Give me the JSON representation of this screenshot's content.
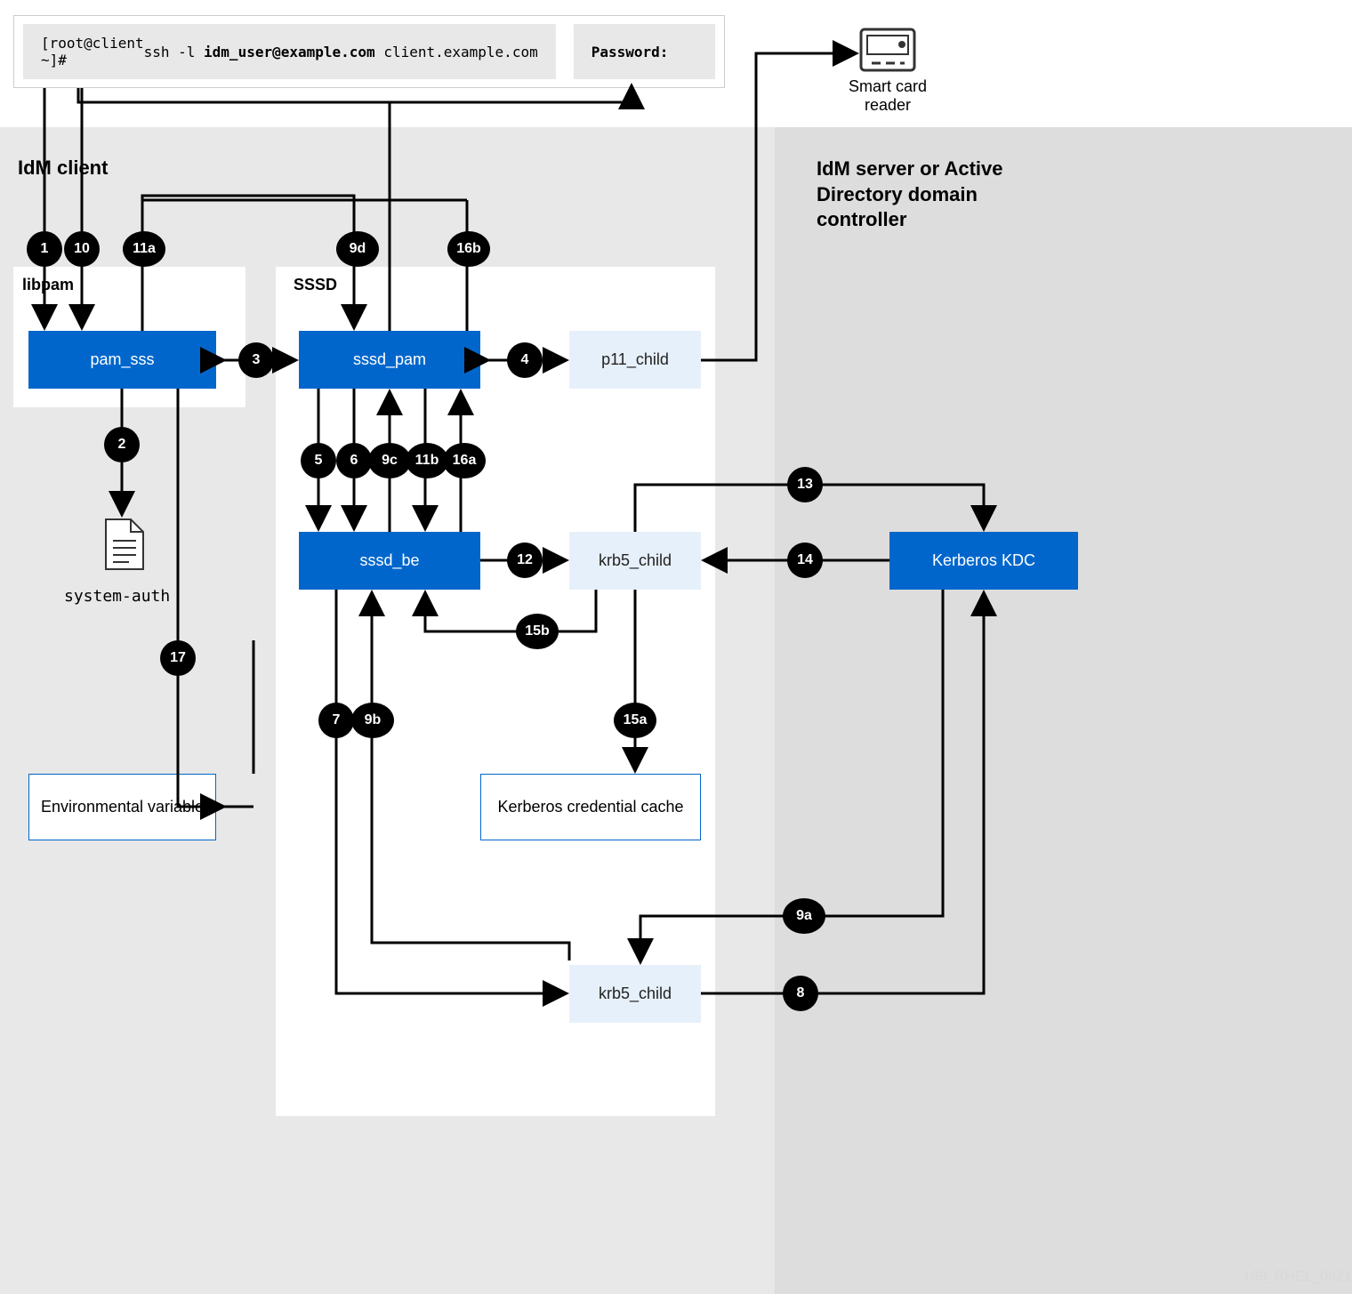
{
  "terminal": {
    "prompt": "[root@client ~]# ",
    "ssh_cmd_1": "ssh -l ",
    "ssh_user": "idm_user@example.com",
    "ssh_cmd_2": " client.example.com",
    "password_label": "Password:"
  },
  "smartcard": {
    "label": "Smart card reader"
  },
  "idm_client_label": "IdM client",
  "idm_server_label": "IdM server or Active Directory domain controller",
  "libpam_label": "libpam",
  "sssd_label": "SSSD",
  "boxes": {
    "pam_sss": "pam_sss",
    "sssd_pam": "sssd_pam",
    "sssd_be": "sssd_be",
    "p11_child": "p11_child",
    "krb5_child_1": "krb5_child",
    "krb5_child_2": "krb5_child",
    "kerberos_kdc": "Kerberos KDC",
    "env_var": "Environmental variable",
    "kerb_cache": "Kerberos credential cache",
    "system_auth": "system-auth"
  },
  "badges": {
    "1": "1",
    "2": "2",
    "3": "3",
    "4": "4",
    "5": "5",
    "6": "6",
    "7": "7",
    "8": "8",
    "9a": "9a",
    "9b": "9b",
    "9c": "9c",
    "9d": "9d",
    "10": "10",
    "11a": "11a",
    "11b": "11b",
    "12": "12",
    "13": "13",
    "14": "14",
    "15a": "15a",
    "15b": "15b",
    "16a": "16a",
    "16b": "16b",
    "17": "17"
  },
  "footer_code": "169_RHEL_0621"
}
